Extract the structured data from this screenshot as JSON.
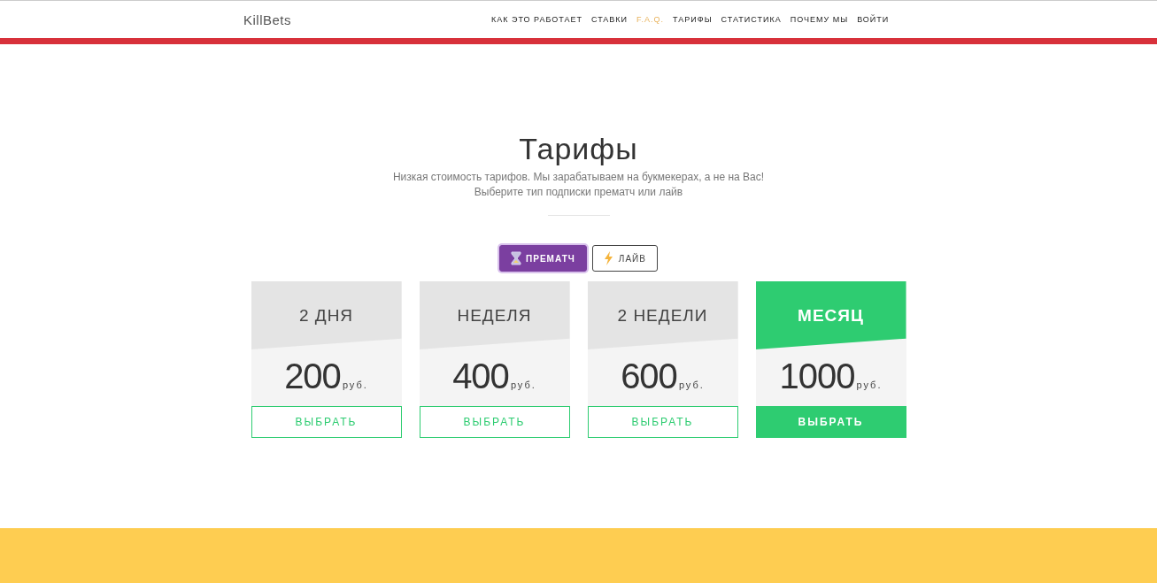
{
  "brand": "KillBets",
  "nav": [
    {
      "label": "КАК ЭТО РАБОТАЕТ",
      "selected": false
    },
    {
      "label": "СТАВКИ",
      "selected": false
    },
    {
      "label": "F.A.Q.",
      "selected": true
    },
    {
      "label": "ТАРИФЫ",
      "selected": false
    },
    {
      "label": "СТАТИСТИКА",
      "selected": false
    },
    {
      "label": "ПОЧЕМУ МЫ",
      "selected": false
    },
    {
      "label": "ВОЙТИ",
      "selected": false
    }
  ],
  "title": "Тарифы",
  "subtitle": [
    "Низкая стоимость тарифов. Мы зарабатываем на букмекерах, а не на Вас!",
    "Выберите тип подписки прематч или лайв"
  ],
  "toggle": [
    {
      "label": "ПРЕМАТЧ",
      "kind": "hourglass",
      "selected": true
    },
    {
      "label": "ЛАЙВ",
      "kind": "lightning",
      "selected": false
    }
  ],
  "plans": [
    {
      "name": "2 ДНЯ",
      "price": "200",
      "currency": "руб.",
      "button": "ВЫБРАТЬ",
      "featured": false
    },
    {
      "name": "НЕДЕЛЯ",
      "price": "400",
      "currency": "руб.",
      "button": "ВЫБРАТЬ",
      "featured": false
    },
    {
      "name": "2 НЕДЕЛИ",
      "price": "600",
      "currency": "руб.",
      "button": "ВЫБРАТЬ",
      "featured": false
    },
    {
      "name": "МЕСЯЦ",
      "price": "1000",
      "currency": "руб.",
      "button": "ВЫБРАТЬ",
      "featured": true
    }
  ]
}
